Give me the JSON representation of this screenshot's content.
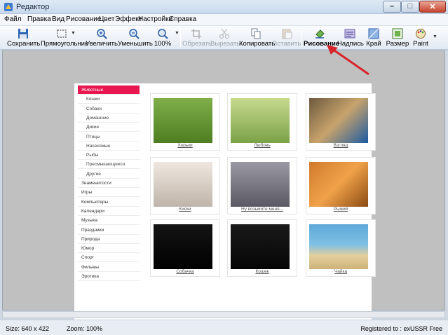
{
  "window": {
    "title": "Редактор"
  },
  "menu": [
    "Файл",
    "Правка",
    "Вид",
    "Рисование",
    "Цвет",
    "Эффект",
    "Настройки",
    "Справка"
  ],
  "toolbar": {
    "save": "Сохранить",
    "rectangle": "Прямоугольник",
    "zoom_in": "Увеличить",
    "zoom_out": "Уменьшить",
    "zoom_level": "100%",
    "crop": "Обрезать",
    "cut": "Вырезать",
    "copy": "Копировать",
    "paste": "Вставить",
    "drawing": "Рисование",
    "caption": "Надпись",
    "edge": "Край",
    "size": "Размер",
    "paint": "Paint"
  },
  "canvas": {
    "categories": [
      {
        "label": "Животные",
        "active": true,
        "sub": false
      },
      {
        "label": "Кошки",
        "sub": true
      },
      {
        "label": "Собаки",
        "sub": true
      },
      {
        "label": "Домашние",
        "sub": true
      },
      {
        "label": "Дикие",
        "sub": true
      },
      {
        "label": "Птицы",
        "sub": true
      },
      {
        "label": "Насекомые",
        "sub": true
      },
      {
        "label": "Рыбы",
        "sub": true
      },
      {
        "label": "Пресмыкающиеся",
        "sub": true
      },
      {
        "label": "Другие",
        "sub": true
      },
      {
        "label": "Знаменитости",
        "sub": false
      },
      {
        "label": "Игры",
        "sub": false
      },
      {
        "label": "Компьютеры",
        "sub": false
      },
      {
        "label": "Календари",
        "sub": false
      },
      {
        "label": "Музыка",
        "sub": false
      },
      {
        "label": "Праздники",
        "sub": false
      },
      {
        "label": "Природа",
        "sub": false
      },
      {
        "label": "Юмор",
        "sub": false
      },
      {
        "label": "Спорт",
        "sub": false
      },
      {
        "label": "Фильмы",
        "sub": false
      },
      {
        "label": "Эротика",
        "sub": false
      }
    ],
    "photos": [
      {
        "caption": "Хорьки"
      },
      {
        "caption": "Любовь"
      },
      {
        "caption": "Взгляд"
      },
      {
        "caption": "Киски"
      },
      {
        "caption": "Ну возьмите меня..."
      },
      {
        "caption": "Рыжий"
      },
      {
        "caption": "Собачка"
      },
      {
        "caption": "Кошек"
      },
      {
        "caption": "Чайка"
      }
    ]
  },
  "status": {
    "size": "Size: 640 x 422",
    "zoom": "Zoom: 100%",
    "registered": "Registered to : exUSSR Free"
  },
  "colors": {
    "accent": "#e8174f",
    "arrow": "#d8232a"
  }
}
